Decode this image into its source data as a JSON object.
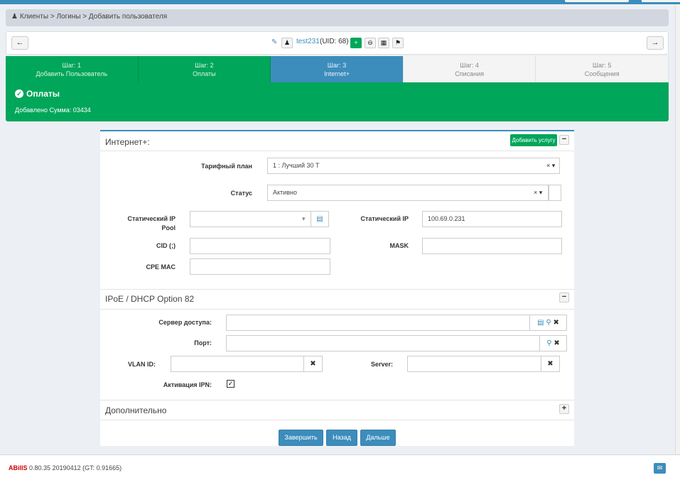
{
  "breadcrumb": {
    "text": "Клиенты > Логины > Добавить пользователя"
  },
  "user": {
    "name": "test231",
    "uid": "(UID: 68)"
  },
  "steps": [
    {
      "line1": "Шаг: 1",
      "line2": "Добавить Пользователь"
    },
    {
      "line1": "Шаг: 2",
      "line2": "Оплаты"
    },
    {
      "line1": "Шаг: 3",
      "line2": "Internet+"
    },
    {
      "line1": "Шаг: 4",
      "line2": "Списания"
    },
    {
      "line1": "Шаг: 5",
      "line2": "Сообщения"
    }
  ],
  "alert": {
    "title": "Оплаты",
    "text": "Добавлено Сумма: 03434"
  },
  "internet": {
    "title": "Интернет+:",
    "add_service": "Добавить услугу",
    "tariff_label": "Тарифный план",
    "tariff_value": "1 : Лучший 30 Т",
    "status_label": "Статус",
    "status_value": "Активно",
    "static_pool_label_1": "Статический IP",
    "static_pool_label_2": "Pool",
    "static_ip_label": "Статический IP",
    "static_ip_value": "100.69.0.231",
    "cid_label": "CID (;)",
    "mask_label": "MASK",
    "cpe_label": "CPE MAC"
  },
  "ipoe": {
    "title": "IPoE / DHCP Option 82",
    "nas_label": "Сервер доступа:",
    "port_label": "Порт:",
    "vlan_label": "VLAN ID:",
    "server_label": "Server:",
    "ipn_label": "Активация IPN:",
    "ipn_checked": true
  },
  "extra": {
    "title": "Дополнительно"
  },
  "buttons": {
    "finish": "Завершить",
    "back": "Назад",
    "next": "Дальше"
  },
  "footer": {
    "brand": "ABillS",
    "version": "0.80.35 20190412 (GT: 0.91665)"
  },
  "colors": {
    "primary": "#3c8dbc",
    "success": "#00a65a"
  }
}
